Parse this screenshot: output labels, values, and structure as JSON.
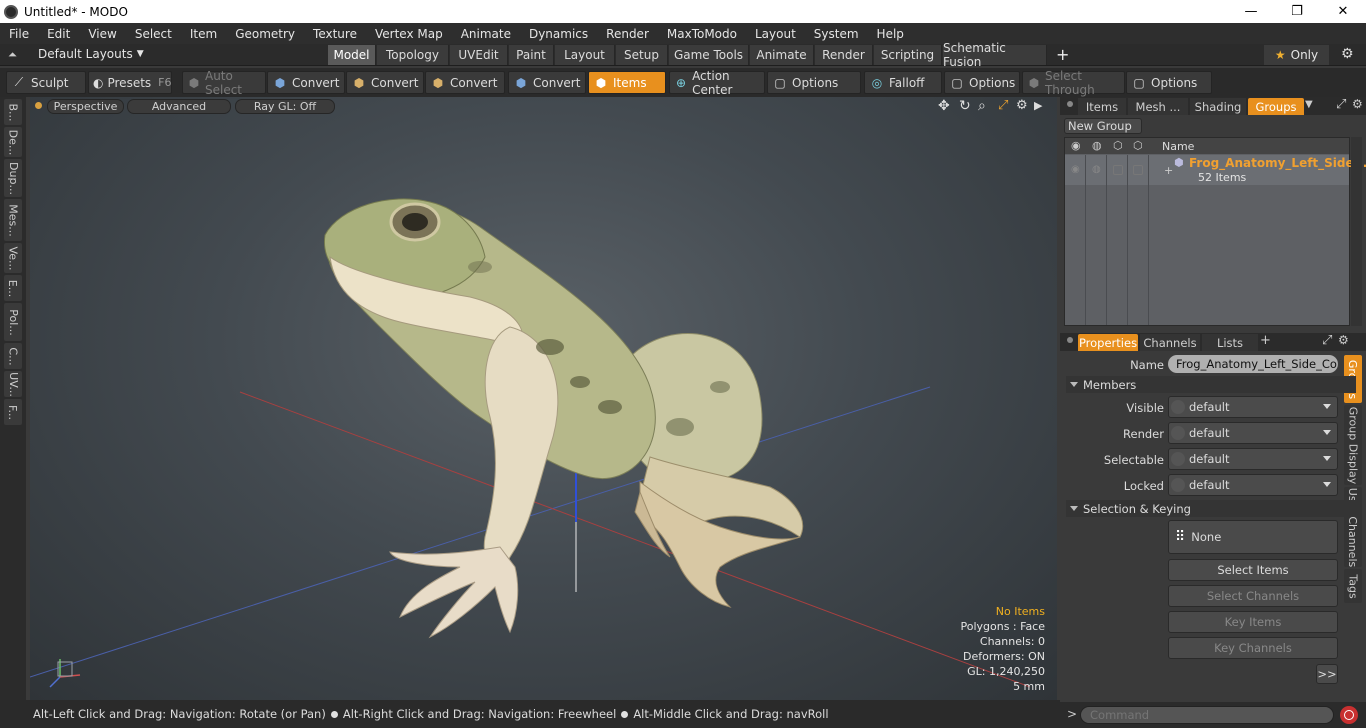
{
  "window": {
    "title": "Untitled* - MODO",
    "min": "—",
    "max": "❐",
    "close": "✕"
  },
  "menu": [
    "File",
    "Edit",
    "View",
    "Select",
    "Item",
    "Geometry",
    "Texture",
    "Vertex Map",
    "Animate",
    "Dynamics",
    "Render",
    "MaxToModo",
    "Layout",
    "System",
    "Help"
  ],
  "layoutbar": {
    "layouts_label": "Default Layouts",
    "tabs": [
      "Model",
      "Topology",
      "UVEdit",
      "Paint",
      "Layout",
      "Setup",
      "Game Tools",
      "Animate",
      "Render",
      "Scripting",
      "Schematic Fusion"
    ],
    "add": "+",
    "only": "Only"
  },
  "toolbar": {
    "sculpt": "Sculpt",
    "presets": "Presets",
    "presets_key": "F6",
    "auto_select": "Auto Select",
    "convert": "Convert",
    "items": "Items",
    "action_center": "Action Center",
    "options": "Options",
    "falloff": "Falloff",
    "select_through": "Select Through"
  },
  "lefttabs": [
    "B...",
    "De...",
    "Dup...",
    "Mes...",
    "Ve...",
    "E...",
    "Pol...",
    "C...",
    "UV...",
    "F..."
  ],
  "viewport": {
    "perspective": "Perspective",
    "advanced": "Advanced",
    "raygl": "Ray GL: Off",
    "info": {
      "no_items": "No Items",
      "polygons": "Polygons : Face",
      "channels": "Channels: 0",
      "deformers": "Deformers: ON",
      "gl": "GL: 1,240,250",
      "scale": "5 mm"
    }
  },
  "statusbar": {
    "part1": "Alt-Left Click and Drag: Navigation: Rotate (or Pan)",
    "part2": "Alt-Right Click and Drag: Navigation: Freewheel",
    "part3": "Alt-Middle Click and Drag: navRoll"
  },
  "groups_panel": {
    "tabs": [
      "Items",
      "Mesh ...",
      "Shading",
      "Groups"
    ],
    "new_group": "New Group",
    "name_col": "Name",
    "group_name": "Frog_Anatomy_Left_Side...",
    "group_count": "52 Items"
  },
  "properties_panel": {
    "tabs": [
      "Properties",
      "Channels",
      "Lists"
    ],
    "side_tabs": [
      "Groups",
      "Group Display",
      "User Channels",
      "Tags"
    ],
    "name_label": "Name",
    "name_value": "Frog_Anatomy_Left_Side_Colore",
    "members": "Members",
    "visible_label": "Visible",
    "render_label": "Render",
    "selectable_label": "Selectable",
    "locked_label": "Locked",
    "dropdown_value": "default",
    "selection_keying": "Selection & Keying",
    "none": "None",
    "select_items": "Select Items",
    "select_channels": "Select Channels",
    "key_items": "Key Items",
    "key_channels": "Key Channels",
    "more": ">>"
  },
  "command": {
    "placeholder": "Command",
    "prompt": ">"
  },
  "colors": {
    "accent": "#e8901e",
    "group_name": "#f0a030"
  }
}
